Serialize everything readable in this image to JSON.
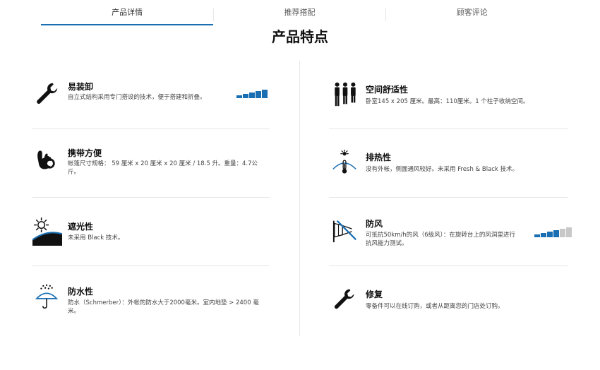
{
  "tabs": [
    {
      "label": "产品详情"
    },
    {
      "label": "推荐搭配"
    },
    {
      "label": "顾客评论"
    }
  ],
  "heading": "产品特点",
  "features": [
    {
      "title": "易装卸",
      "desc": "自立式结构采用专门搭设的技术，便于搭建和折叠。",
      "icon": "wrench-icon",
      "meter": {
        "filled": 5,
        "total": 5
      }
    },
    {
      "title": "携带方便",
      "desc": "帐篷尺寸规格： 59 厘米 x 20 厘米 x 20 厘米 / 18.5 升。重量：4.7公斤。",
      "icon": "ok-hand-icon"
    },
    {
      "title": "遮光性",
      "desc": "未采用 Black 技术。",
      "icon": "sun-shade-icon"
    },
    {
      "title": "防水性",
      "desc": "防水（Schmerber）：外帐的防水大于2000毫米。室内地垫 > 2400 毫米。",
      "icon": "rain-umbrella-icon"
    },
    {
      "title": "空间舒适性",
      "desc": "卧室145 x 205 厘米。最高：110厘米。1 个柱子收纳空间。",
      "icon": "people-icon"
    },
    {
      "title": "排热性",
      "desc": "没有外帐，侧面通风较好。未采用 Fresh & Black 技术。",
      "icon": "heat-thermometer-icon"
    },
    {
      "title": "防风",
      "desc": "可抵抗50km/h的风（6级风）：在旋转台上的风洞里进行抗风能力测试。",
      "icon": "windsock-icon",
      "meter": {
        "filled": 4,
        "total": 6
      }
    },
    {
      "title": "修复",
      "desc": "零备件可以在线订购，或者从距离您的门店处订购。",
      "icon": "wrench-icon"
    }
  ],
  "colors": {
    "accent": "#1a6fb3",
    "meter_on": "#1a6fb3",
    "meter_off": "#c8c8c8",
    "icon": "#111111"
  }
}
